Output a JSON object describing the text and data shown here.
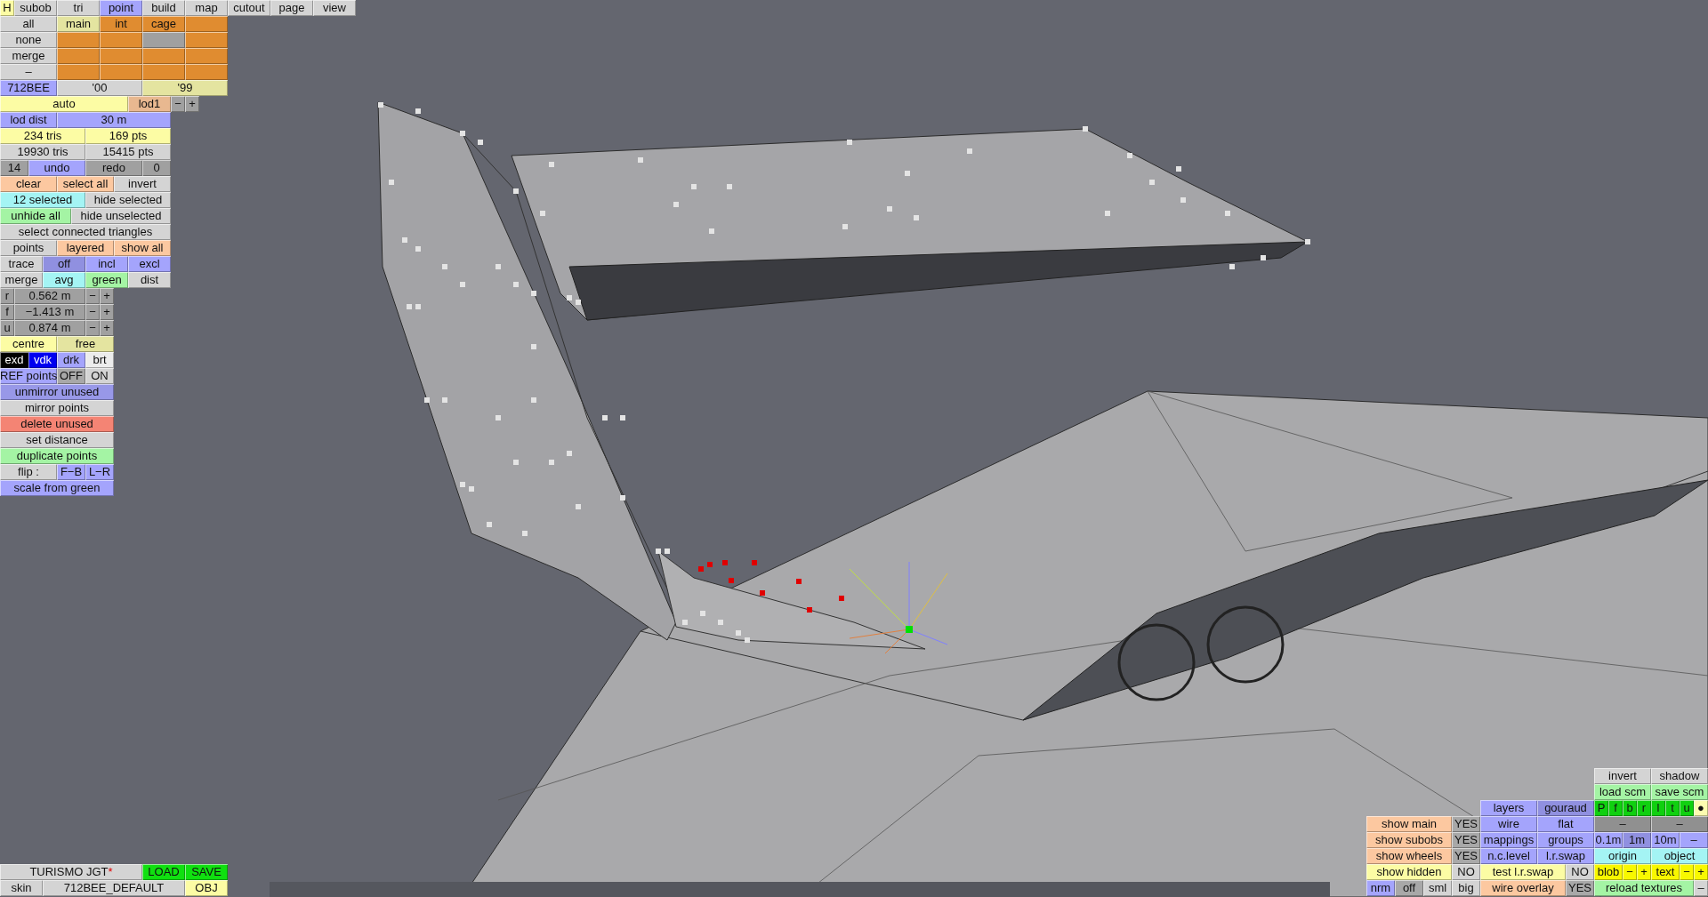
{
  "top_left": {
    "help": "H",
    "tabs": [
      {
        "label": "subob",
        "selected": false
      },
      {
        "label": "tri",
        "selected": false
      },
      {
        "label": "point",
        "selected": true
      },
      {
        "label": "build",
        "selected": false
      },
      {
        "label": "map",
        "selected": false
      },
      {
        "label": "cutout",
        "selected": false
      },
      {
        "label": "page",
        "selected": false
      },
      {
        "label": "view",
        "selected": false
      }
    ],
    "rows": [
      [
        {
          "label": "all",
          "color": "#d4d4d4"
        },
        {
          "label": "main",
          "color": "#e4e4a0"
        },
        {
          "label": "int",
          "color": "#e08c30"
        },
        {
          "label": "cage",
          "color": "#e08c30"
        },
        {
          "color": "#e08c30"
        }
      ],
      [
        {
          "label": "none",
          "color": "#d4d4d4"
        },
        {
          "color": "#e08c30"
        },
        {
          "color": "#e08c30"
        },
        {
          "color": "#a0a0a0"
        },
        {
          "color": "#e08c30"
        }
      ],
      [
        {
          "label": "merge",
          "color": "#d4d4d4"
        },
        {
          "color": "#e08c30"
        },
        {
          "color": "#e08c30"
        },
        {
          "color": "#e08c30"
        },
        {
          "color": "#e08c30"
        }
      ],
      [
        {
          "label": "–",
          "color": "#d4d4d4"
        },
        {
          "color": "#e08c30"
        },
        {
          "color": "#e08c30"
        },
        {
          "color": "#e08c30"
        },
        {
          "color": "#e08c30"
        }
      ],
      [
        {
          "label": "712BEE",
          "color": "#a4a4fc"
        },
        {
          "label": "'00",
          "color": "#d4d4d4"
        },
        {
          "label": "'99",
          "color": "#e4e4a0"
        }
      ],
      [
        {
          "label": "auto",
          "color": "#fcfca4"
        },
        {
          "label": "lod1",
          "color": "#e8b890"
        },
        {
          "label": "−",
          "color": "#a0a0a0"
        },
        {
          "label": "+",
          "color": "#a0a0a0"
        }
      ],
      [
        {
          "label": "lod dist",
          "color": "#a4a4fc"
        },
        {
          "label": "30 m",
          "color": "#a4a4fc"
        }
      ],
      [
        {
          "label": "234 tris",
          "color": "#fcfca4"
        },
        {
          "label": "169 pts",
          "color": "#fcfca4"
        }
      ],
      [
        {
          "label": "19930 tris",
          "color": "#d4d4d4"
        },
        {
          "label": "15415 pts",
          "color": "#d4d4d4"
        }
      ],
      [
        {
          "label": "14",
          "color": "#a0a0a0"
        },
        {
          "label": "undo",
          "color": "#a4a4fc"
        },
        {
          "label": "redo",
          "color": "#a0a0a0"
        },
        {
          "label": "0",
          "color": "#a0a0a0"
        }
      ],
      [
        {
          "label": "clear",
          "color": "#fcc8a0"
        },
        {
          "label": "select all",
          "color": "#fcc8a0"
        },
        {
          "label": "invert",
          "color": "#d4d4d4"
        }
      ],
      [
        {
          "label": "12 selected",
          "color": "#a4f4f4"
        },
        {
          "label": "hide selected",
          "color": "#d4d4d4"
        }
      ],
      [
        {
          "label": "unhide all",
          "color": "#a4f4a4"
        },
        {
          "label": "hide unselected",
          "color": "#d4d4d4"
        }
      ],
      [
        {
          "label": "select connected triangles",
          "color": "#d4d4d4"
        }
      ],
      [
        {
          "label": "points",
          "color": "#d4d4d4"
        },
        {
          "label": "layered",
          "color": "#fcc8a0"
        },
        {
          "label": "show all",
          "color": "#fcc8a0"
        }
      ],
      [
        {
          "label": "trace",
          "color": "#d4d4d4"
        },
        {
          "label": "off",
          "color": "#9090e0"
        },
        {
          "label": "incl",
          "color": "#a4a4fc"
        },
        {
          "label": "excl",
          "color": "#a4a4fc"
        }
      ],
      [
        {
          "label": "merge",
          "color": "#d4d4d4"
        },
        {
          "label": "avg",
          "color": "#a4f4f4"
        },
        {
          "label": "green",
          "color": "#a4f4a4"
        },
        {
          "label": "dist",
          "color": "#d4d4d4"
        }
      ],
      [
        {
          "label": "r",
          "color": "#a0a0a0"
        },
        {
          "label": "0.562 m",
          "color": "#a0a0a0"
        },
        {
          "label": "−",
          "color": "#a0a0a0"
        },
        {
          "label": "+",
          "color": "#a0a0a0"
        }
      ],
      [
        {
          "label": "f",
          "color": "#a0a0a0"
        },
        {
          "label": "−1.413 m",
          "color": "#a0a0a0"
        },
        {
          "label": "−",
          "color": "#a0a0a0"
        },
        {
          "label": "+",
          "color": "#a0a0a0"
        }
      ],
      [
        {
          "label": "u",
          "color": "#a0a0a0"
        },
        {
          "label": "0.874 m",
          "color": "#a0a0a0"
        },
        {
          "label": "−",
          "color": "#a0a0a0"
        },
        {
          "label": "+",
          "color": "#a0a0a0"
        }
      ],
      [
        {
          "label": "centre",
          "color": "#fcfca4"
        },
        {
          "label": "free",
          "color": "#e4e4a0"
        }
      ],
      [
        {
          "label": "exd",
          "color": "#000000"
        },
        {
          "label": "vdk",
          "color": "#0000f0"
        },
        {
          "label": "drk",
          "color": "#a4a4fc"
        },
        {
          "label": "brt",
          "color": "#ececec"
        }
      ],
      [
        {
          "label": "REF points",
          "color": "#a4a4fc"
        },
        {
          "label": "OFF",
          "color": "#a8a8a8"
        },
        {
          "label": "ON",
          "color": "#d4d4d4"
        }
      ],
      [
        {
          "label": "unmirror unused",
          "color": "#9898e8"
        }
      ],
      [
        {
          "label": "mirror points",
          "color": "#d4d4d4"
        }
      ],
      [
        {
          "label": "delete unused",
          "color": "#f48474"
        }
      ],
      [
        {
          "label": "set distance",
          "color": "#d4d4d4"
        }
      ],
      [
        {
          "label": "duplicate points",
          "color": "#a4f4a4"
        }
      ],
      [
        {
          "label": "flip :",
          "color": "#d4d4d4"
        },
        {
          "label": "F−B",
          "color": "#a4a4fc"
        },
        {
          "label": "L−R",
          "color": "#a4a4fc"
        }
      ],
      [
        {
          "label": "scale from green",
          "color": "#a4a4fc"
        }
      ]
    ]
  },
  "bottom_left": {
    "rows": [
      [
        {
          "label": "TURISMO JGT",
          "modified_mark": "*",
          "color": "#d4d4d4"
        },
        {
          "label": "LOAD",
          "color": "#10e010"
        },
        {
          "label": "SAVE",
          "color": "#10e010"
        }
      ],
      [
        {
          "label": "skin",
          "color": "#d4d4d4"
        },
        {
          "label": "712BEE_DEFAULT",
          "color": "#d4d4d4"
        },
        {
          "label": "OBJ",
          "color": "#fcfca4"
        }
      ]
    ]
  },
  "bottom_right": {
    "display_toggles": [
      [
        {
          "label": "show main",
          "color": "#fcc8a0"
        },
        {
          "label": "YES",
          "color": "#a8a8a8"
        }
      ],
      [
        {
          "label": "show subobs",
          "color": "#fcc8a0"
        },
        {
          "label": "YES",
          "color": "#a8a8a8"
        }
      ],
      [
        {
          "label": "show wheels",
          "color": "#fcc8a0"
        },
        {
          "label": "YES",
          "color": "#a8a8a8"
        }
      ],
      [
        {
          "label": "show hidden",
          "color": "#fcfca4"
        },
        {
          "label": "NO",
          "color": "#d4d4d4"
        }
      ],
      [
        {
          "label": "nrm",
          "color": "#a4a4fc"
        },
        {
          "label": "off",
          "color": "#a8a8a8"
        },
        {
          "label": "sml",
          "color": "#d4d4d4"
        },
        {
          "label": "big",
          "color": "#d4d4d4"
        }
      ]
    ],
    "render_modes": [
      [
        {
          "label": "layers",
          "color": "#a4a4fc"
        },
        {
          "label": "gouraud",
          "color": "#9090e0"
        }
      ],
      [
        {
          "label": "wire",
          "color": "#a4a4fc"
        },
        {
          "label": "flat",
          "color": "#a4a4fc"
        }
      ],
      [
        {
          "label": "mappings",
          "color": "#a4a4fc"
        },
        {
          "label": "groups",
          "color": "#a4a4fc"
        }
      ],
      [
        {
          "label": "n.c.level",
          "color": "#a4a4fc"
        },
        {
          "label": "l.r.swap",
          "color": "#a4a4fc"
        }
      ],
      [
        {
          "label": "test l.r.swap",
          "color": "#fcfca4"
        },
        {
          "label": "NO",
          "color": "#d4d4d4"
        }
      ],
      [
        {
          "label": "wire overlay",
          "color": "#fcc8a0"
        },
        {
          "label": "YES",
          "color": "#a8a8a8"
        }
      ]
    ],
    "view_controls": [
      [
        {
          "label": "invert",
          "color": "#d4d4d4"
        },
        {
          "label": "shadow",
          "color": "#d4d4d4"
        }
      ],
      [
        {
          "label": "load scm",
          "color": "#a4f4a4"
        },
        {
          "label": "save scm",
          "color": "#a4f4a4"
        }
      ],
      [
        {
          "label": "P",
          "color": "#10d010"
        },
        {
          "label": "f",
          "color": "#10d010"
        },
        {
          "label": "b",
          "color": "#10d010"
        },
        {
          "label": "r",
          "color": "#10d010"
        },
        {
          "label": "l",
          "color": "#10d010"
        },
        {
          "label": "t",
          "color": "#10d010"
        },
        {
          "label": "u",
          "color": "#10d010"
        },
        {
          "label": "●",
          "color": "#fcfcb0"
        }
      ],
      [
        {
          "label": "–",
          "color": "#909090"
        },
        {
          "label": "–",
          "color": "#909090"
        }
      ],
      [
        {
          "label": "0.1m",
          "color": "#a4a4fc"
        },
        {
          "label": "1m",
          "color": "#9090e0"
        },
        {
          "label": "10m",
          "color": "#a4a4fc"
        },
        {
          "label": "–",
          "color": "#a4a4fc"
        }
      ],
      [
        {
          "label": "origin",
          "color": "#a4f4f4"
        },
        {
          "label": "object",
          "color": "#a4f4f4"
        }
      ],
      [
        {
          "label": "blob",
          "color": "#f8f800"
        },
        {
          "label": "−",
          "color": "#f8f800"
        },
        {
          "label": "+",
          "color": "#f8f800"
        },
        {
          "label": "text",
          "color": "#f8f800"
        },
        {
          "label": "−",
          "color": "#f8f800"
        },
        {
          "label": "+",
          "color": "#f8f800"
        }
      ],
      [
        {
          "label": "reload textures",
          "color": "#a4f4a4"
        },
        {
          "label": "–",
          "color": "#d4d4d4"
        }
      ]
    ]
  }
}
